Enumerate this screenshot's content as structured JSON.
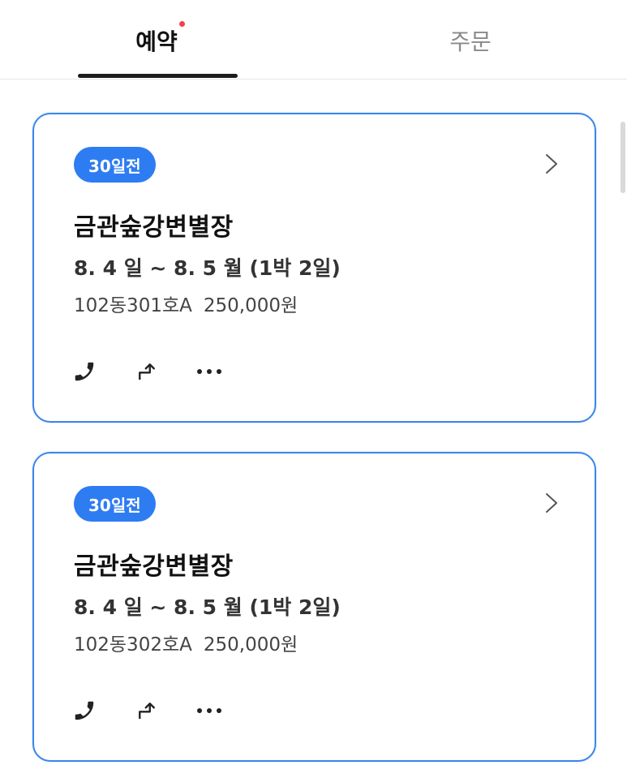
{
  "tabs": [
    {
      "label": "예약",
      "active": true,
      "has_dot": true
    },
    {
      "label": "주문",
      "active": false
    }
  ],
  "colors": {
    "accent": "#2e7cf2",
    "card_border": "#3b86ea",
    "dot": "#f0424a",
    "indicator": "#1c1c1c"
  },
  "bookings": [
    {
      "badge": "30일전",
      "name": "금관숲강변별장",
      "dates": "8. 4 일 ~ 8. 5 월 (1박 2일)",
      "room": "102동301호A",
      "price": "250,000원",
      "actions": [
        "phone-icon",
        "share-icon",
        "more-icon"
      ]
    },
    {
      "badge": "30일전",
      "name": "금관숲강변별장",
      "dates": "8. 4 일 ~ 8. 5 월 (1박 2일)",
      "room": "102동302호A",
      "price": "250,000원",
      "actions": [
        "phone-icon",
        "share-icon",
        "more-icon"
      ]
    }
  ]
}
